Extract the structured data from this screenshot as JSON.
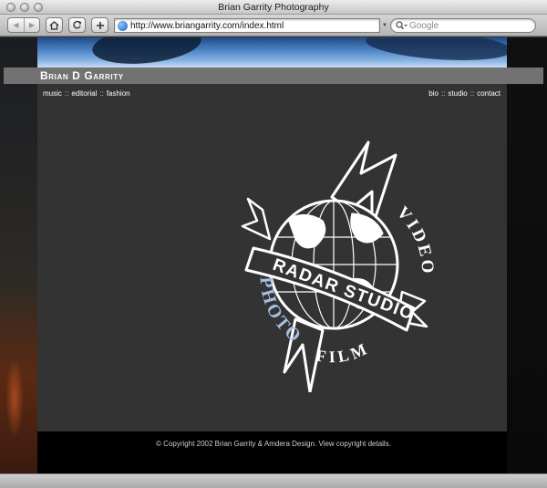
{
  "window": {
    "title": "Brian Garrity Photography"
  },
  "toolbar": {
    "url": "http://www.briangarrity.com/index.html",
    "search_placeholder": "Google"
  },
  "site": {
    "name": "Brian D Garrity",
    "nav_left": [
      "music",
      "editorial",
      "fashion"
    ],
    "nav_right": [
      "bio",
      "studio",
      "contact"
    ],
    "nav_separator": "::"
  },
  "logo": {
    "banner_text": "RADAR STUDIO",
    "word_left": "PHOTO",
    "word_right": "VIDEO",
    "word_bottom": "FILM",
    "accent_color": "#a7bde6"
  },
  "footer": {
    "copyright": "© Copyright 2002 Brian Garrity & Amdera Design. View copyright details."
  },
  "colors": {
    "page_bg": "#333333",
    "namebar": "#727272",
    "frame": "#000000"
  }
}
